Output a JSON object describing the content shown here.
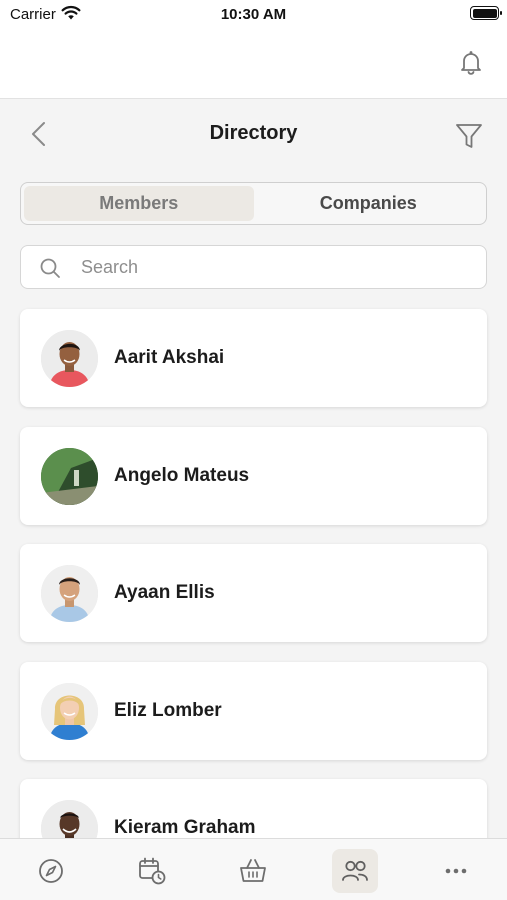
{
  "status_bar": {
    "carrier": "Carrier",
    "time": "10:30 AM"
  },
  "header": {
    "title": "Directory",
    "back_icon": "chevron-left-icon",
    "filter_icon": "filter-icon",
    "notification_icon": "bell-icon"
  },
  "tabs": {
    "members_label": "Members",
    "companies_label": "Companies",
    "active": "Members"
  },
  "search": {
    "placeholder": "Search"
  },
  "members": [
    {
      "name": "Aarit Akshai"
    },
    {
      "name": "Angelo Mateus"
    },
    {
      "name": "Ayaan Ellis"
    },
    {
      "name": "Eliz Lomber"
    },
    {
      "name": "Kieram Graham"
    }
  ],
  "bottom_nav": {
    "items": [
      "compass-icon",
      "calendar-clock-icon",
      "basket-icon",
      "people-icon",
      "more-icon"
    ],
    "active": "people-icon"
  },
  "colors": {
    "background": "#f4f4f4",
    "active_highlight": "#ece9e4",
    "text": "#1c1c1c"
  }
}
